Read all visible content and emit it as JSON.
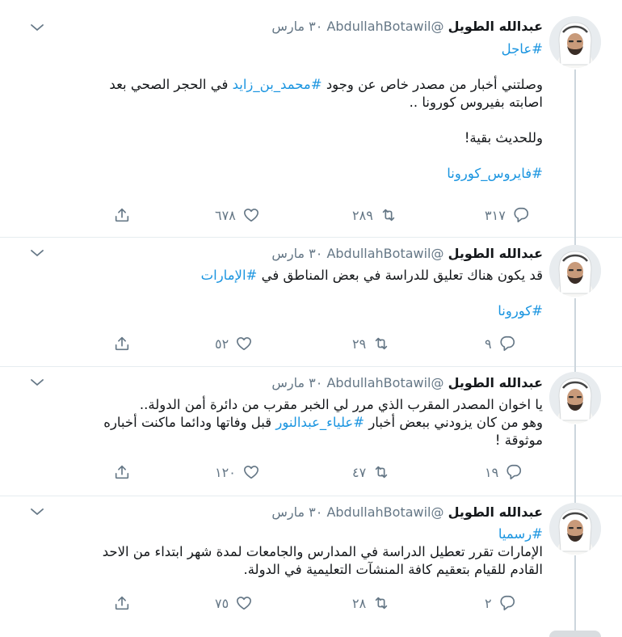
{
  "tweets": [
    {
      "name": "عبدالله الطويل",
      "handle": "@AbdullahBotawil",
      "date": "٣٠ مارس",
      "lines": [
        [
          {
            "t": "#عاجل",
            "tag": true
          }
        ],
        [
          {
            "t": "",
            "tag": false
          }
        ],
        [
          {
            "t": "وصلتني أخبار من مصدر خاص عن وجود ",
            "tag": false
          },
          {
            "t": "#محمد_بن_زايد",
            "tag": true
          },
          {
            "t": " في الحجر الصحي بعد",
            "tag": false
          }
        ],
        [
          {
            "t": "اصابته بفيروس كورونا ..",
            "tag": false
          }
        ],
        [
          {
            "t": "",
            "tag": false
          }
        ],
        [
          {
            "t": "وللحديث بقية!",
            "tag": false
          }
        ],
        [
          {
            "t": "",
            "tag": false
          }
        ],
        [
          {
            "t": "#فايروس_كورونا",
            "tag": true
          }
        ]
      ],
      "replies": "٣١٧",
      "retweets": "٢٨٩",
      "likes": "٦٧٨"
    },
    {
      "name": "عبدالله الطويل",
      "handle": "@AbdullahBotawil",
      "date": "٣٠ مارس",
      "lines": [
        [
          {
            "t": "قد يكون هناك تعليق للدراسة في بعض المناطق في ",
            "tag": false
          },
          {
            "t": "#الإمارات",
            "tag": true
          }
        ],
        [
          {
            "t": "",
            "tag": false
          }
        ],
        [
          {
            "t": "#كورونا",
            "tag": true
          }
        ]
      ],
      "replies": "٩",
      "retweets": "٢٩",
      "likes": "٥٢"
    },
    {
      "name": "عبدالله الطويل",
      "handle": "@AbdullahBotawil",
      "date": "٣٠ مارس",
      "lines": [
        [
          {
            "t": "يا اخوان المصدر المقرب الذي مرر لي الخبر مقرب من دائرة أمن الدولة..",
            "tag": false
          }
        ],
        [
          {
            "t": "وهو من كان يزودني ببعض أخبار ",
            "tag": false
          },
          {
            "t": "#علياء_عبدالنور",
            "tag": true
          },
          {
            "t": " قبل وفاتها ودائما ماكنت أخباره",
            "tag": false
          }
        ],
        [
          {
            "t": "موثوقة !",
            "tag": false
          }
        ]
      ],
      "replies": "١٩",
      "retweets": "٤٧",
      "likes": "١٢٠"
    },
    {
      "name": "عبدالله الطويل",
      "handle": "@AbdullahBotawil",
      "date": "٣٠ مارس",
      "lines": [
        [
          {
            "t": "#رسميا",
            "tag": true
          }
        ],
        [
          {
            "t": "الإمارات تقرر تعطيل الدراسة في المدارس والجامعات لمدة شهر ابتداء من الاحد",
            "tag": false
          }
        ],
        [
          {
            "t": "القادم للقيام بتعقيم كافة المنشآت التعليمية في الدولة.",
            "tag": false
          }
        ]
      ],
      "replies": "٢",
      "retweets": "٢٨",
      "likes": "٧٥"
    }
  ],
  "icons": {
    "reply": "reply-icon",
    "retweet": "retweet-icon",
    "like": "heart-icon",
    "share": "share-icon",
    "more": "chevron-down-icon"
  },
  "colors": {
    "hashtag": "#1b95e0",
    "muted": "#657786",
    "text": "#14171a"
  }
}
